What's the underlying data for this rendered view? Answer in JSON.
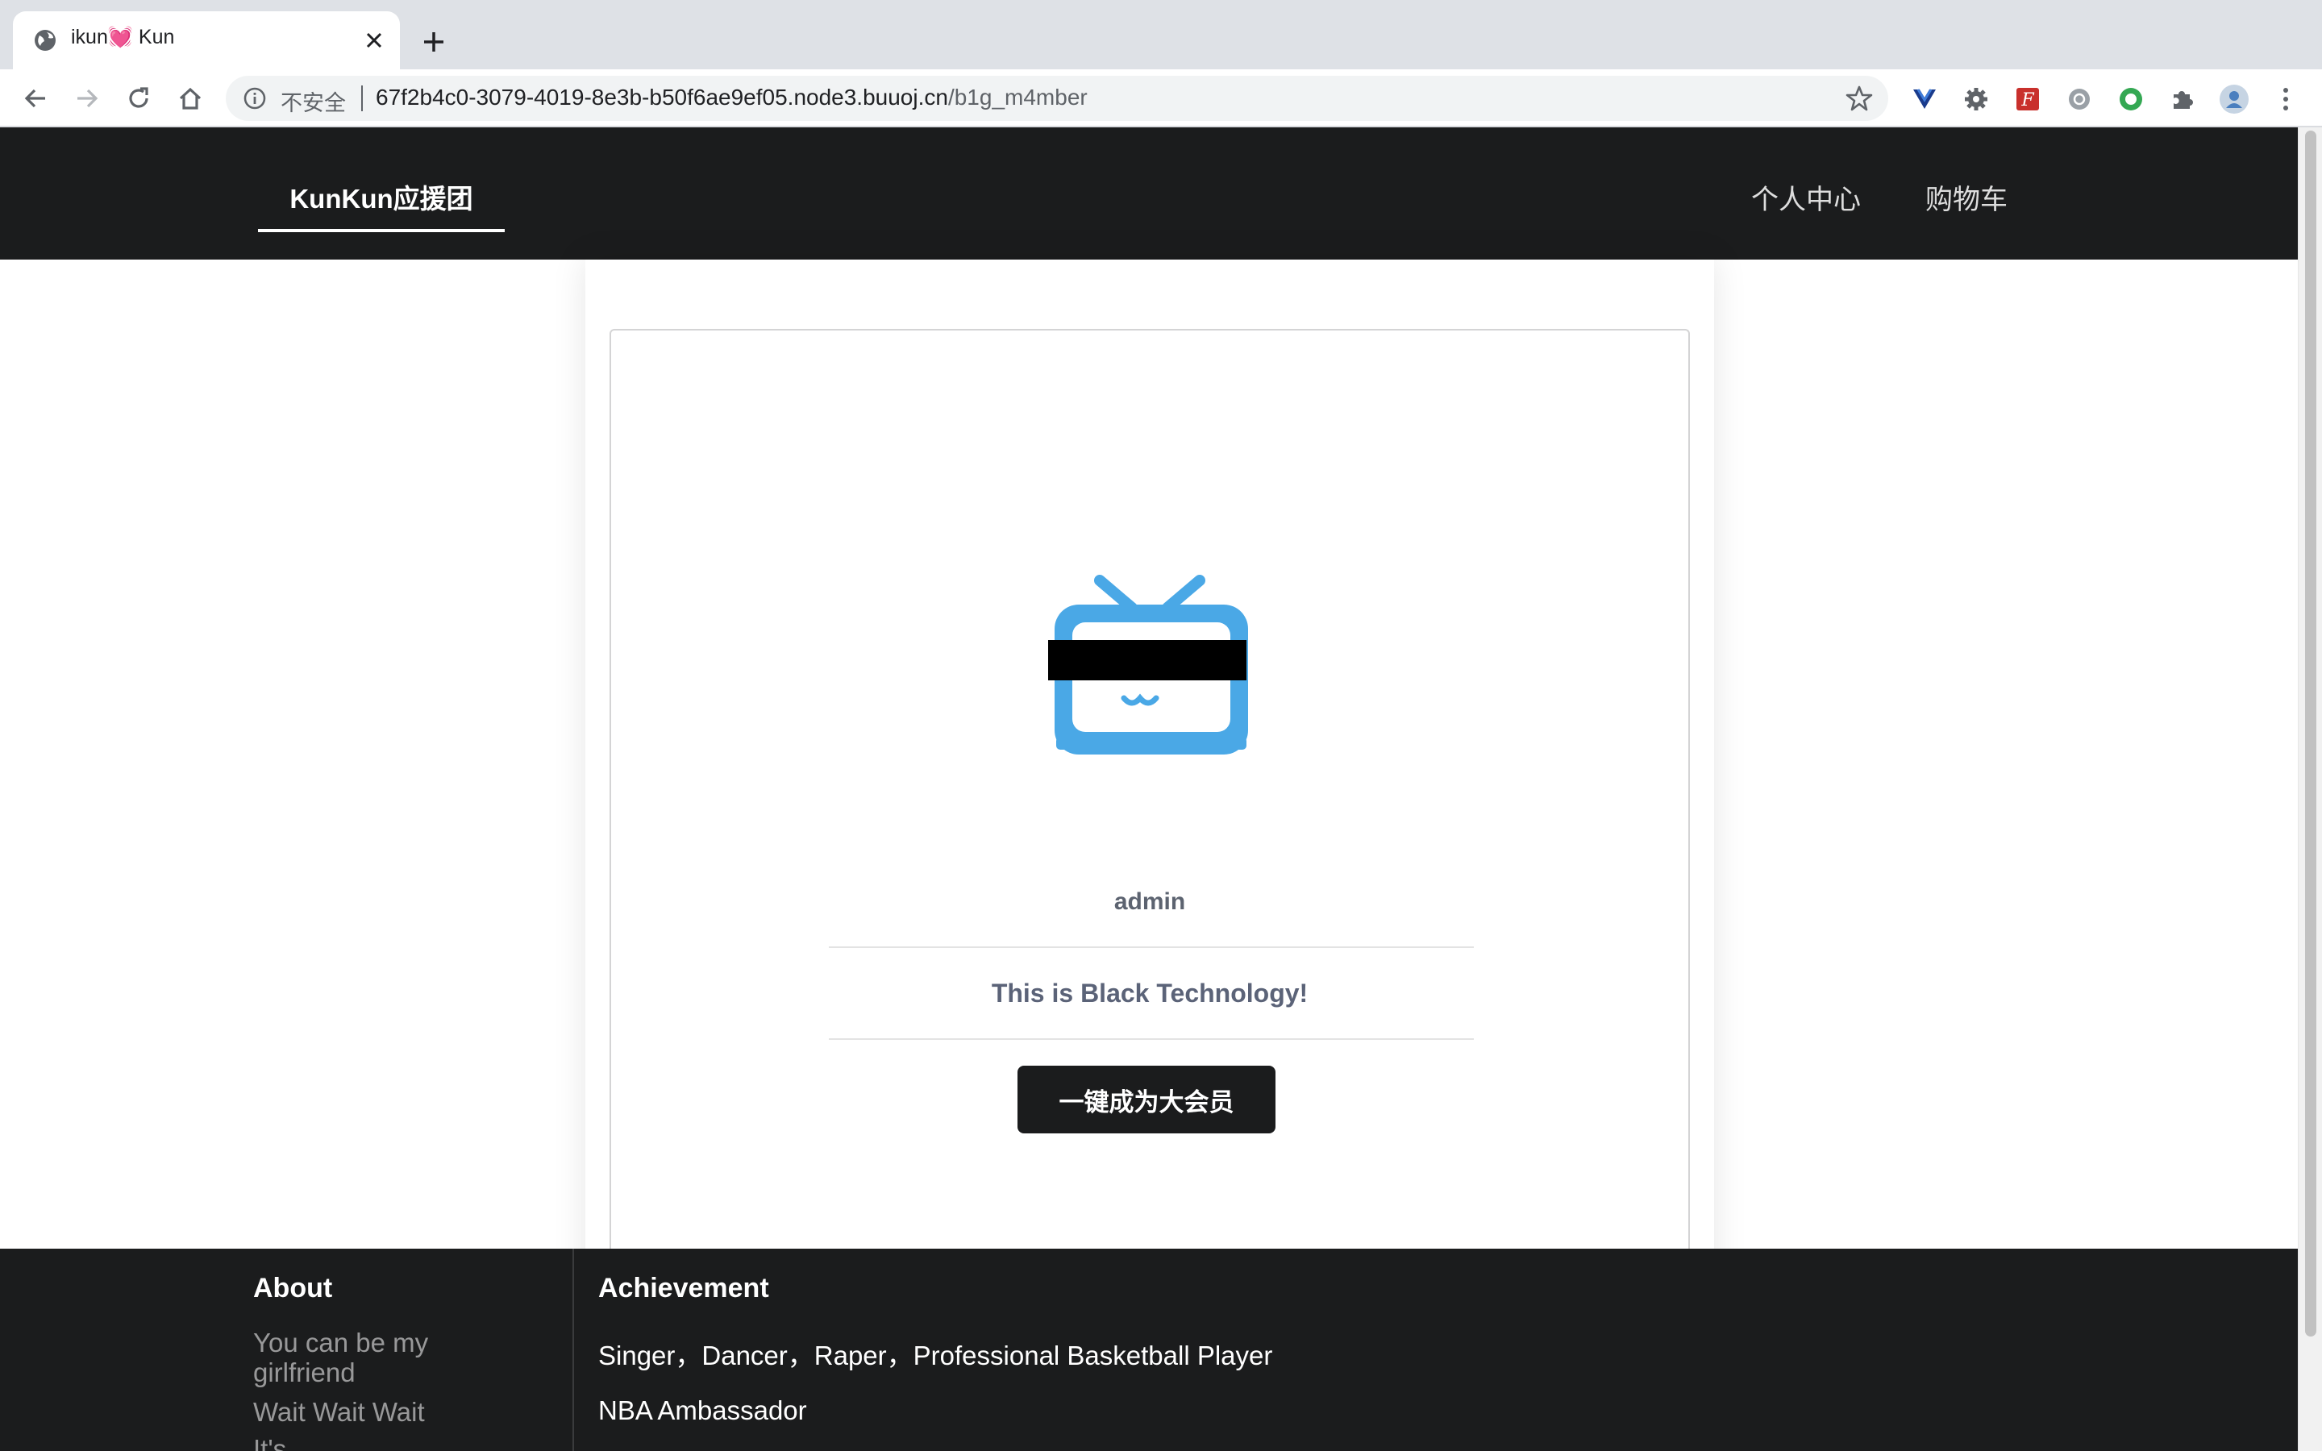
{
  "browser": {
    "tab_title": "ikun💓 Kun",
    "security_label": "不安全",
    "url_host": "67f2b4c0-3079-4019-8e3b-b50f6ae9ef05.node3.buuoj.cn",
    "url_path": "/b1g_m4mber"
  },
  "nav": {
    "brand": "KunKun应援团",
    "links": [
      "个人中心",
      "购物车"
    ]
  },
  "profile": {
    "username": "admin",
    "motto": "This is Black Technology!",
    "vip_button": "一键成为大会员"
  },
  "footer": {
    "about_heading": "About",
    "about_links": [
      "You can be my girlfriend",
      "Wait Wait Wait",
      "It's..."
    ],
    "achievement_heading": "Achievement",
    "achievements": [
      "Singer，Dancer，Raper，Professional Basketball Player",
      "NBA Ambassador"
    ]
  },
  "colors": {
    "nav_bg": "#1b1c1d",
    "logo_blue": "#4aa8e6",
    "censor_bar": "#000000"
  }
}
